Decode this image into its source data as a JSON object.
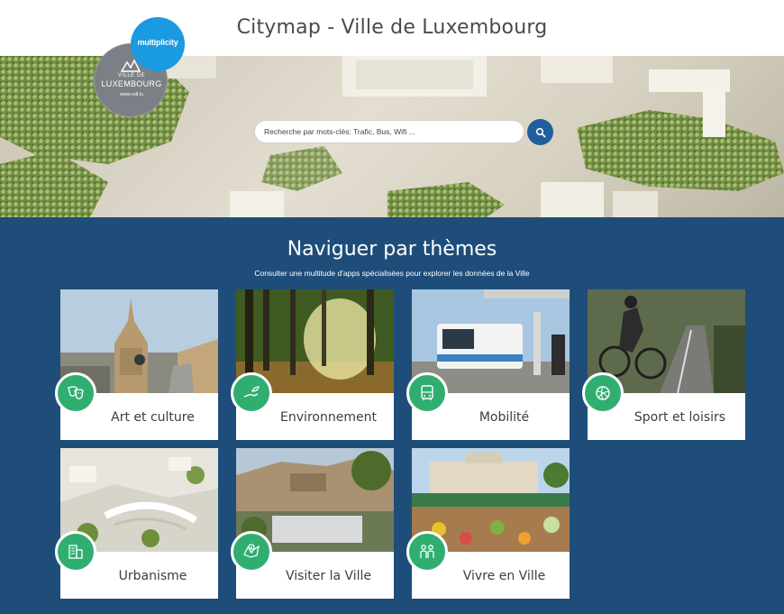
{
  "header": {
    "title": "Citymap - Ville de Luxembourg"
  },
  "logos": {
    "luxembourg": {
      "line1": "VILLE DE",
      "line2": "LUXEMBOURG",
      "line3": "www.vdl.lu"
    },
    "multiplicity": {
      "text": "multiplicity"
    }
  },
  "search": {
    "placeholder": "Recherche par mots-clés: Trafic, Bus, Wifi ...",
    "button_icon": "search-icon"
  },
  "themes_section": {
    "title": "Naviguer par thèmes",
    "subtitle": "Consulter une multitude d'apps spécialisées pour explorer les données de la Ville"
  },
  "cards": [
    {
      "label": "Art et culture",
      "icon": "theatre-masks-icon"
    },
    {
      "label": "Environnement",
      "icon": "hand-leaf-icon"
    },
    {
      "label": "Mobilité",
      "icon": "bus-icon"
    },
    {
      "label": "Sport et loisirs",
      "icon": "volleyball-icon"
    },
    {
      "label": "Urbanisme",
      "icon": "buildings-icon"
    },
    {
      "label": "Visiter la Ville",
      "icon": "map-pin-icon"
    },
    {
      "label": "Vivre en Ville",
      "icon": "people-icon"
    }
  ],
  "colors": {
    "section_bg": "#1e4d7a",
    "icon_green": "#2fae70",
    "search_button": "#1f5f9c",
    "multiplicity_blue": "#1a9ae1",
    "luxembourg_gray": "#7c7f85"
  }
}
